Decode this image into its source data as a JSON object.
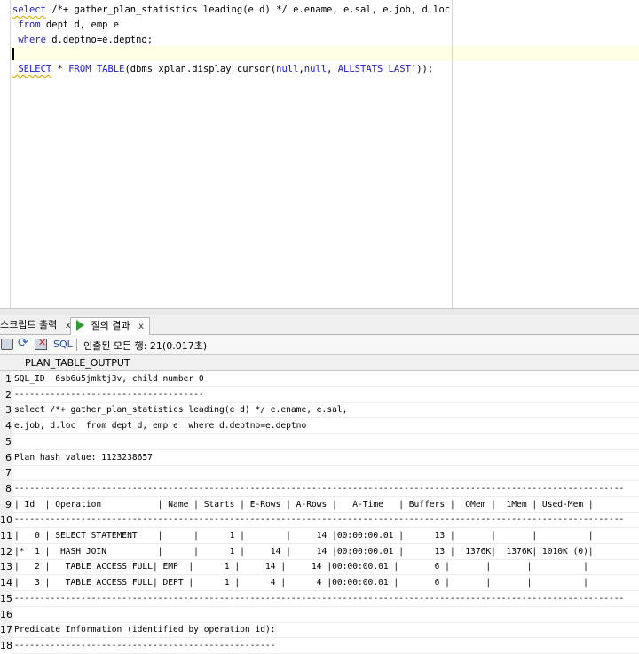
{
  "editor": {
    "lines": [
      {
        "parts": [
          [
            "select",
            "kw squig"
          ],
          [
            " /*+ gather_plan_statistics leading(e d) */ e.ename, e.sal, e.job, d.loc",
            ""
          ]
        ]
      },
      {
        "parts": [
          [
            " from",
            "kw"
          ],
          [
            " dept d, emp e",
            ""
          ]
        ]
      },
      {
        "parts": [
          [
            " where",
            "kw"
          ],
          [
            " d.deptno=e.deptno;",
            ""
          ]
        ]
      },
      {
        "parts": [
          [
            "",
            ""
          ]
        ]
      },
      {
        "parts": [
          [
            " SELECT",
            "kw squig"
          ],
          [
            " * ",
            ""
          ],
          [
            "FROM TABLE",
            "kw"
          ],
          [
            "(dbms_xplan.display_cursor(",
            ""
          ],
          [
            "null",
            "kw"
          ],
          [
            ",",
            ""
          ],
          [
            "null",
            "kw"
          ],
          [
            ",",
            ""
          ],
          [
            "'ALLSTATS LAST'",
            "kw"
          ],
          [
            "));",
            ""
          ]
        ]
      }
    ]
  },
  "tabs": {
    "script_output": "스크립트 출력",
    "query_result": "질의 결과",
    "close": "x"
  },
  "toolbar": {
    "sql_label": "SQL",
    "fetch_status": "인출된 모든 행: 21(0.017초)"
  },
  "grid": {
    "column_header": "PLAN_TABLE_OUTPUT",
    "rows": [
      {
        "n": "1",
        "text": "SQL_ID  6sb6u5jmktj3v, child number 0"
      },
      {
        "n": "2",
        "text": "-------------------------------------"
      },
      {
        "n": "3",
        "text": "select /*+ gather_plan_statistics leading(e d) */ e.ename, e.sal,"
      },
      {
        "n": "4",
        "text": "e.job, d.loc  from dept d, emp e  where d.deptno=e.deptno"
      },
      {
        "n": "5",
        "text": ""
      },
      {
        "n": "6",
        "text": "Plan hash value: 1123238657"
      },
      {
        "n": "7",
        "text": ""
      },
      {
        "n": "8",
        "text": "-----------------------------------------------------------------------------------------------------------------------"
      },
      {
        "n": "9",
        "text": "| Id  | Operation           | Name | Starts | E-Rows | A-Rows |   A-Time   | Buffers |  OMem |  1Mem | Used-Mem |"
      },
      {
        "n": "10",
        "text": "-----------------------------------------------------------------------------------------------------------------------"
      },
      {
        "n": "11",
        "text": "|   0 | SELECT STATEMENT    |      |      1 |        |     14 |00:00:00.01 |      13 |       |       |          |"
      },
      {
        "n": "12",
        "text": "|*  1 |  HASH JOIN          |      |      1 |     14 |     14 |00:00:00.01 |      13 |  1376K|  1376K| 1010K (0)|"
      },
      {
        "n": "13",
        "text": "|   2 |   TABLE ACCESS FULL| EMP  |      1 |     14 |     14 |00:00:00.01 |       6 |       |       |          |"
      },
      {
        "n": "14",
        "text": "|   3 |   TABLE ACCESS FULL| DEPT |      1 |      4 |      4 |00:00:00.01 |       6 |       |       |          |"
      },
      {
        "n": "15",
        "text": "-----------------------------------------------------------------------------------------------------------------------"
      },
      {
        "n": "16",
        "text": ""
      },
      {
        "n": "17",
        "text": "Predicate Information (identified by operation id):"
      },
      {
        "n": "18",
        "text": "---------------------------------------------------"
      }
    ]
  }
}
